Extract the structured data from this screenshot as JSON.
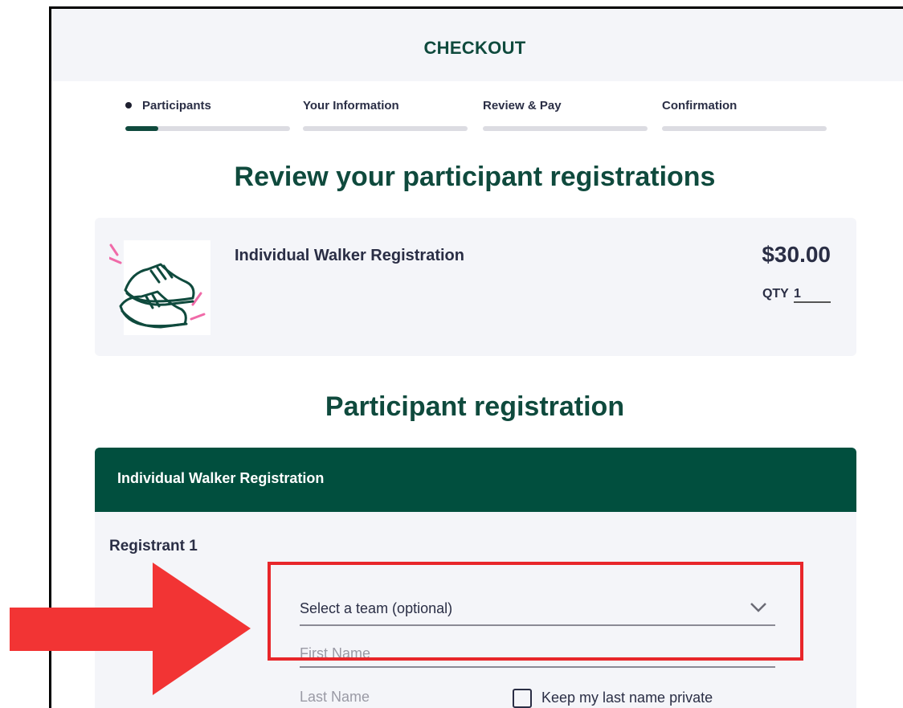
{
  "header": {
    "title": "CHECKOUT"
  },
  "steps": [
    {
      "label": "Participants",
      "active": true,
      "progress": 0.2
    },
    {
      "label": "Your Information",
      "active": false,
      "progress": 0
    },
    {
      "label": "Review & Pay",
      "active": false,
      "progress": 0
    },
    {
      "label": "Confirmation",
      "active": false,
      "progress": 0
    }
  ],
  "review": {
    "heading": "Review your participant registrations",
    "item": {
      "name": "Individual Walker Registration",
      "price": "$30.00",
      "qty_label": "QTY",
      "qty_value": "1",
      "icon": "sneaker-icon"
    }
  },
  "registration": {
    "heading": "Participant registration",
    "panel_title": "Individual Walker Registration",
    "registrant_label": "Registrant 1",
    "team_select": {
      "value": "Select a team (optional)",
      "icon": "chevron-down-icon"
    },
    "first_name": {
      "placeholder": "First Name"
    },
    "last_name": {
      "placeholder": "Last Name"
    },
    "keep_private_label": "Keep my last name private"
  },
  "colors": {
    "brand_green": "#014f3e",
    "heading_green": "#0f4a3d",
    "highlight_red": "#e8262a",
    "panel_bg": "#f4f5f9"
  }
}
